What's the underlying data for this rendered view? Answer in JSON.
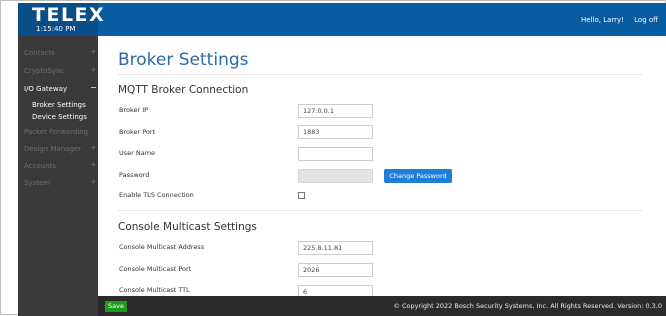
{
  "header": {
    "logo_text": "TELEX",
    "time": "1:15:40 PM",
    "greeting": "Hello, Larry!",
    "logoff_label": "Log off"
  },
  "sidebar": {
    "items": [
      {
        "label": "Contacts",
        "symbol": "+"
      },
      {
        "label": "CryptoSync",
        "symbol": "+"
      },
      {
        "label": "I/O Gateway",
        "symbol": "−"
      },
      {
        "label": "Packet Forwarding",
        "symbol": ""
      },
      {
        "label": "Design Manager",
        "symbol": "+"
      },
      {
        "label": "Accounts",
        "symbol": "+"
      },
      {
        "label": "System",
        "symbol": "+"
      }
    ],
    "subitems": [
      {
        "label": "Broker Settings"
      },
      {
        "label": "Device Settings"
      }
    ]
  },
  "main": {
    "page_title": "Broker Settings",
    "sections": [
      {
        "title": "MQTT Broker Connection",
        "fields": [
          {
            "label": "Broker IP",
            "value": "127.0.0.1"
          },
          {
            "label": "Broker Port",
            "value": "1883"
          },
          {
            "label": "User Name",
            "value": ""
          },
          {
            "label": "Password",
            "value": ""
          },
          {
            "label": "Enable TLS Connection",
            "checked": false
          }
        ],
        "change_password_label": "Change Password"
      },
      {
        "title": "Console Multicast Settings",
        "fields": [
          {
            "label": "Console Multicast Address",
            "value": "225.8.11.81"
          },
          {
            "label": "Console Multicast Port",
            "value": "2026"
          },
          {
            "label": "Console Multicast TTL",
            "value": "6"
          }
        ]
      }
    ]
  },
  "footer": {
    "save_label": "Save",
    "copyright": "© Copyright 2022 Bosch Security Systems, Inc. All Rights Reserved. Version: 0.3.0"
  },
  "colors": {
    "header_bg": "#0a5ca0",
    "sidebar_bg": "#3a3a3a",
    "title": "#2a6aa5",
    "primary_button": "#1e7fdb",
    "save_button": "#1c9a1c",
    "footer_bg": "#2b2b2b"
  }
}
